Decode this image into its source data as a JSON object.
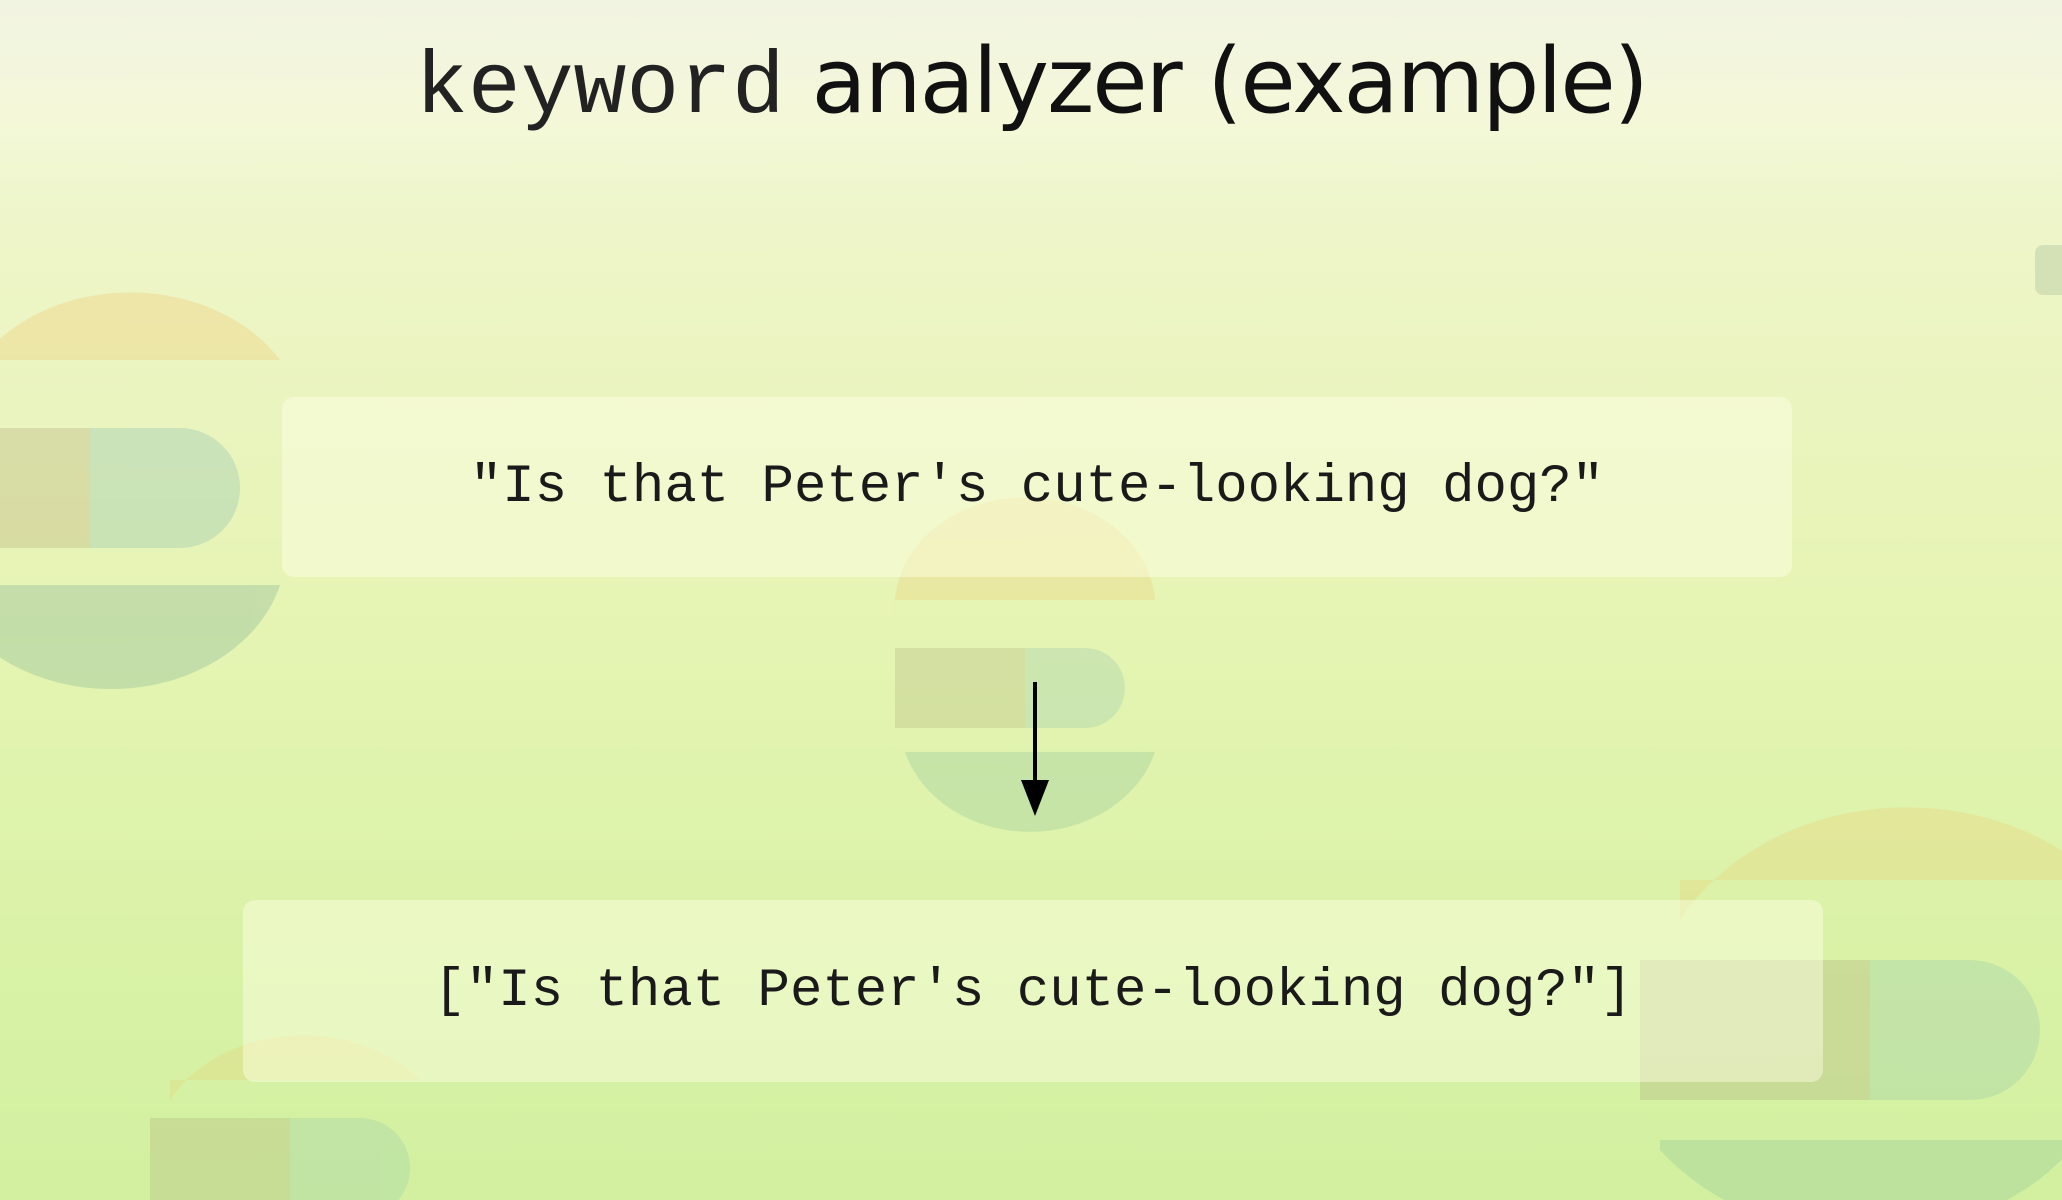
{
  "slide": {
    "title_code": "keyword",
    "title_text": "analyzer (example)"
  },
  "example": {
    "input": "\"Is that Peter's cute-looking dog?\"",
    "output": "[\"Is that Peter's cute-looking dog?\"]"
  },
  "colors": {
    "background_top": "#f4f8dc",
    "background_bottom": "#d2f0a0",
    "text": "#111111"
  },
  "icons": {
    "flow_arrow": "arrow-down-icon"
  }
}
